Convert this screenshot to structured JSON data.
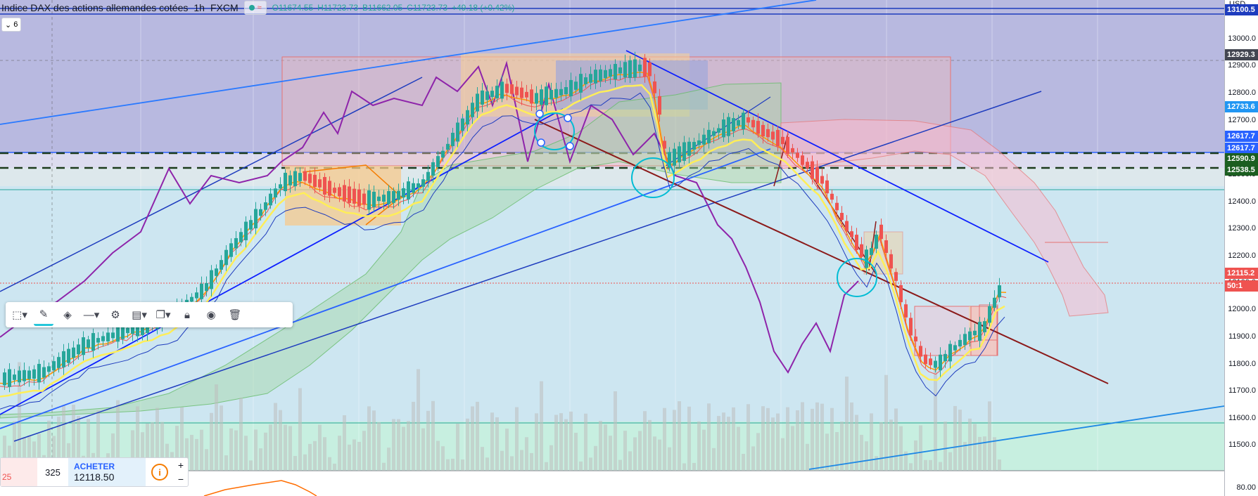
{
  "header": {
    "symbol": "Indice DAX des actions allemandes cotées",
    "interval": "1h",
    "exchange": "FXCM",
    "open": "O11674.55",
    "high": "H11723.73",
    "low": "B11662.05",
    "close": "C11723.73",
    "change": "+49.18 (+0.42%)",
    "indicator_toggle": "≈",
    "collapse_label": "6"
  },
  "price_axis": {
    "currency": "USD",
    "ticks": [
      "13000.0",
      "12900.0",
      "12800.0",
      "12700.0",
      "12600.0",
      "12500.0",
      "12400.0",
      "12300.0",
      "12200.0",
      "12100.0",
      "12000.0",
      "11900.0",
      "11800.0",
      "11700.0",
      "11600.0",
      "11500.0"
    ],
    "sub_tick": "80.00",
    "badges": [
      {
        "text": "13100.5",
        "color": "#1e3cbe"
      },
      {
        "text": "12929.3",
        "color": "#434651"
      },
      {
        "text": "12733.6",
        "color": "#2196f3"
      },
      {
        "text": "12617.7",
        "color": "#2962ff"
      },
      {
        "text": "12617.7",
        "color": "#2962ff"
      },
      {
        "text": "12590.9",
        "color": "#1b5e20"
      },
      {
        "text": "12538.5",
        "color": "#1b5e20"
      },
      {
        "text": "12115.2",
        "color": "#ef5350"
      },
      {
        "text": "50:1",
        "color": "#ef5350"
      }
    ]
  },
  "toolbar": {
    "icons": [
      "select-area-icon",
      "pencil-icon",
      "fill-bucket-icon",
      "line-style-icon",
      "gear-icon",
      "layers-icon",
      "copy-icon",
      "lock-icon",
      "eye-icon",
      "trash-icon"
    ]
  },
  "trade": {
    "sell_price_fragment": "25",
    "spread": "325",
    "buy_label": "ACHETER",
    "buy_price": "12118.50",
    "info": "i",
    "plus": "+",
    "minus": "−"
  },
  "colors": {
    "bull": "#26a69a",
    "bear": "#ef5350",
    "purple": "#8e24aa",
    "yellow": "#ffee58"
  }
}
